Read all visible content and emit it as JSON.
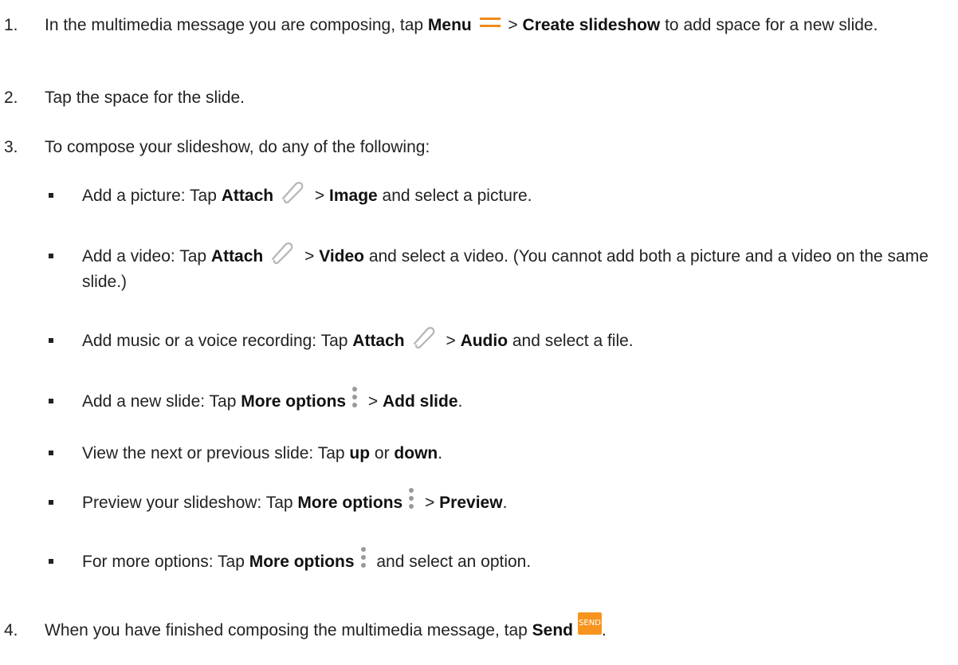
{
  "step1": {
    "num": "1.",
    "t1": "In the multimedia message you are composing, tap ",
    "b1": "Menu",
    "t2": " > ",
    "b2": "Create slideshow",
    "t3": " to add space for a new slide."
  },
  "step2": {
    "num": "2.",
    "t1": "Tap the space for the slide."
  },
  "step3": {
    "num": "3.",
    "t1": "To compose your slideshow, do any of the following:"
  },
  "bullets": {
    "picture": {
      "t1": "Add a picture: Tap ",
      "b1": "Attach",
      "t2": " > ",
      "b2": "Image",
      "t3": " and select a picture."
    },
    "video": {
      "t1": "Add a video: Tap ",
      "b1": "Attach",
      "t2": " > ",
      "b2": "Video",
      "t3": " and select a video. (You cannot add both a picture and a video on the same slide.)"
    },
    "audio": {
      "t1": "Add music or a voice recording: Tap ",
      "b1": "Attach",
      "t2": " > ",
      "b2": "Audio",
      "t3": " and select a file."
    },
    "add_slide": {
      "t1": "Add a new slide: Tap ",
      "b1": "More options",
      "t2": " > ",
      "b2": "Add slide",
      "t3": "."
    },
    "navigate": {
      "t1": "View the next or previous slide: Tap ",
      "b1": "up",
      "t2": " or ",
      "b2": "down",
      "t3": "."
    },
    "preview": {
      "t1": "Preview your slideshow: Tap ",
      "b1": "More options",
      "t2": " > ",
      "b2": "Preview",
      "t3": "."
    },
    "more": {
      "t1": "For more options: Tap ",
      "b1": "More options",
      "t2": " and select an option."
    }
  },
  "step4": {
    "num": "4.",
    "t1": "When you have finished composing the multimedia message, tap ",
    "b1": "Send",
    "t2": "."
  },
  "send_icon_label": "SEND",
  "icons": {
    "menu": "menu-icon",
    "attach": "paperclip-icon",
    "more_options": "more-options-icon",
    "send": "send-icon"
  },
  "colors": {
    "accent": "#f08a1c",
    "send_button": "#f7941d",
    "dots": "#9a9a9a",
    "text": "#222222"
  }
}
